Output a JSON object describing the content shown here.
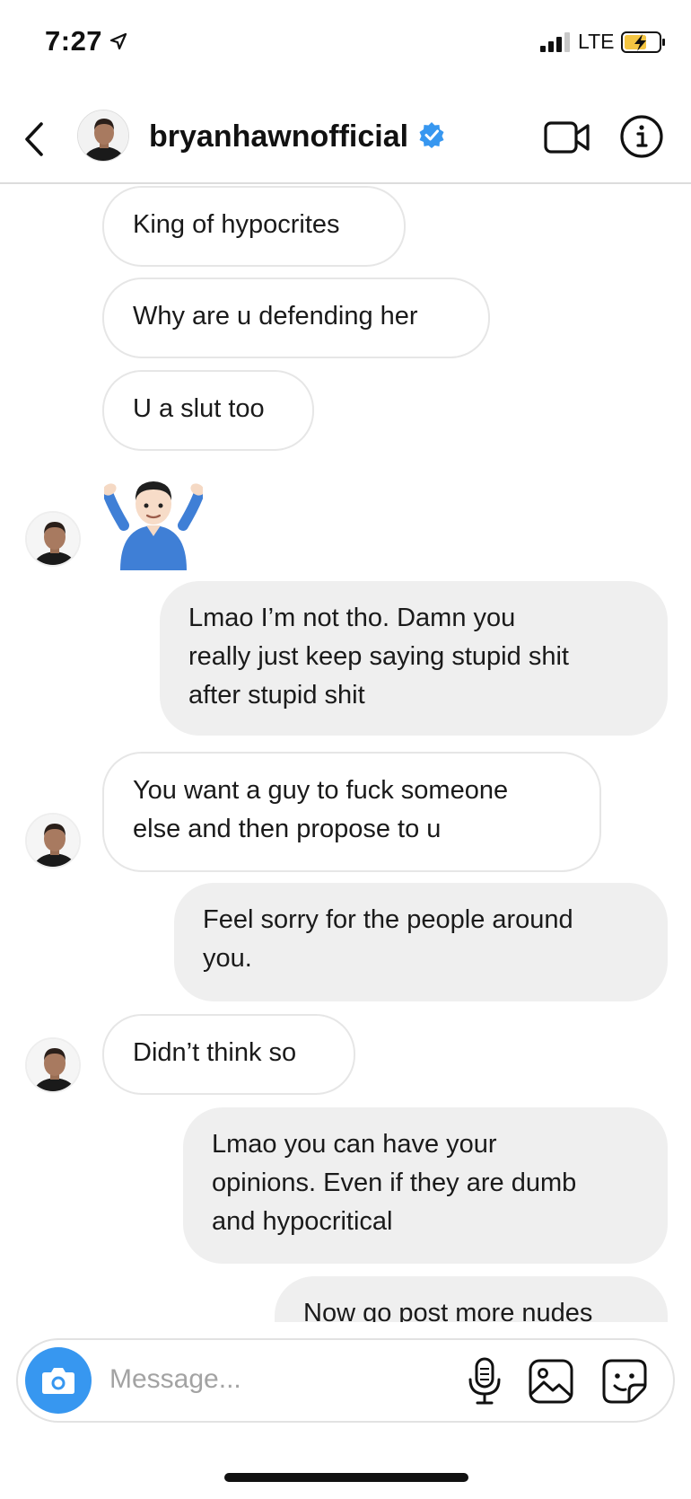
{
  "status_bar": {
    "time": "7:27",
    "network": "LTE"
  },
  "header": {
    "username": "bryanhawnofficial",
    "verified": true,
    "icons": [
      "back-icon",
      "verified-badge-icon",
      "video-call-icon",
      "info-icon"
    ]
  },
  "messages": [
    {
      "from": "them",
      "text": "King of hypocrites"
    },
    {
      "from": "them",
      "text": "Why are u defending her"
    },
    {
      "from": "them",
      "text": "U a slut too"
    },
    {
      "from": "them",
      "type": "emoji",
      "emoji_name": "man-shrugging"
    },
    {
      "from": "me",
      "lines": [
        "Lmao I’m not tho. Damn you",
        "really just keep saying stupid shit",
        "after stupid shit"
      ]
    },
    {
      "from": "them",
      "lines": [
        "You want a guy to fuck someone",
        "else and then propose to u"
      ]
    },
    {
      "from": "me",
      "lines": [
        "Feel sorry for the people around",
        "you."
      ]
    },
    {
      "from": "them",
      "text": "Didn’t think so"
    },
    {
      "from": "me",
      "lines": [
        "Lmao you can have your",
        "opinions. Even if they are dumb",
        "and hypocritical"
      ]
    },
    {
      "from": "me",
      "lines": [
        "Now go post more nudes"
      ]
    }
  ],
  "composer": {
    "placeholder": "Message...",
    "icons": [
      "camera-icon",
      "microphone-icon",
      "gallery-icon",
      "sticker-icon"
    ]
  },
  "colors": {
    "accent_blue": "#3797f0",
    "outgoing_bubble": "#efefef",
    "incoming_border": "#e6e6e6"
  }
}
